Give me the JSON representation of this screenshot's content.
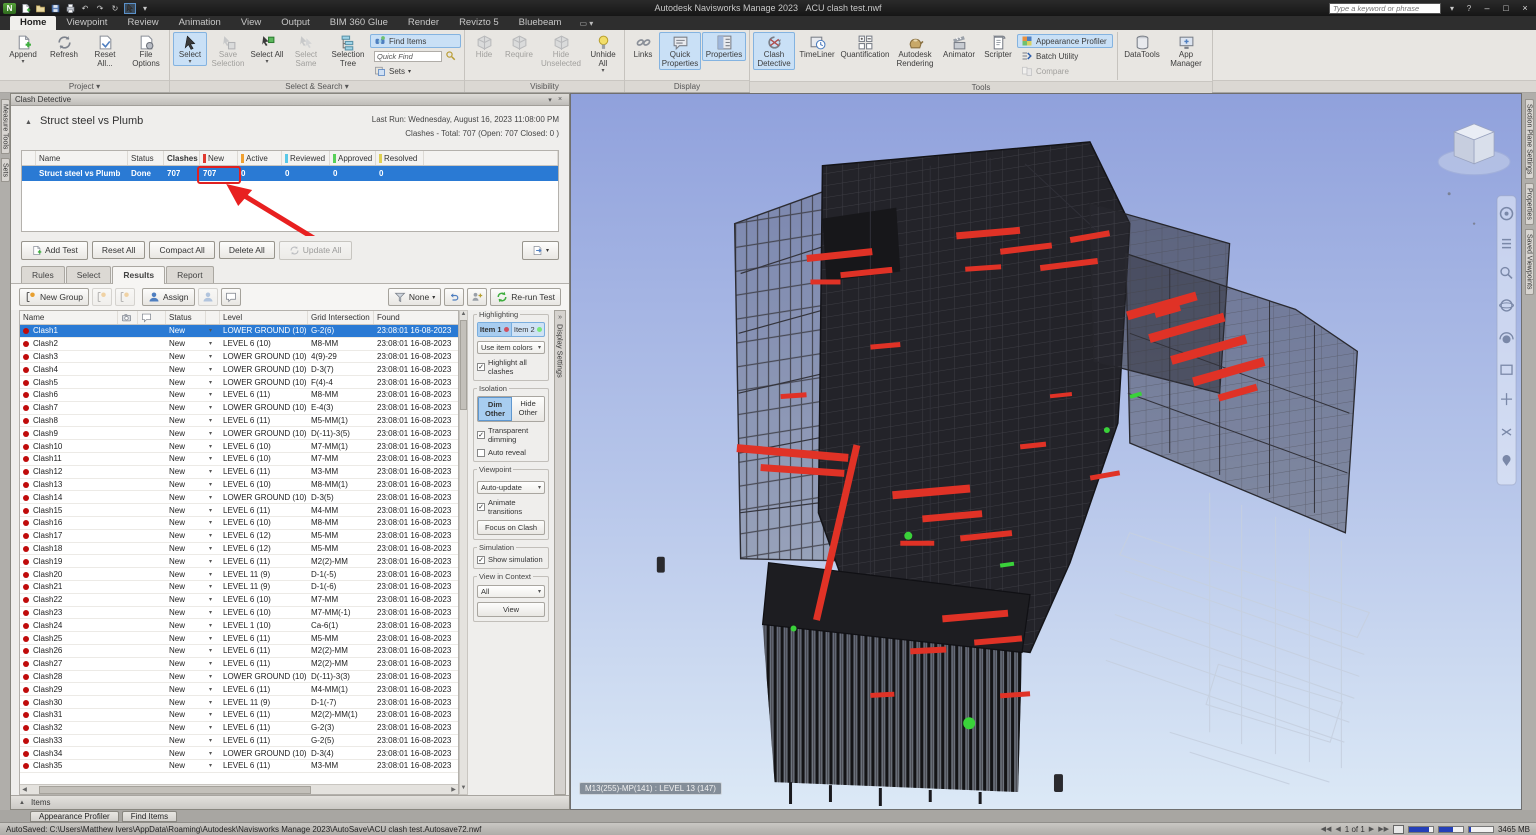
{
  "window": {
    "app_title": "Autodesk Navisworks Manage 2023",
    "doc_title": "ACU clash test.nwf",
    "search_placeholder": "Type a keyword or phrase"
  },
  "ribbon": {
    "tabs": [
      "Home",
      "Viewpoint",
      "Review",
      "Animation",
      "View",
      "Output",
      "BIM 360 Glue",
      "Render",
      "Revizto 5",
      "Bluebeam"
    ],
    "active_tab": "Home",
    "groups": {
      "project": {
        "label": "Project",
        "append": "Append",
        "refresh": "Refresh",
        "reset_all": "Reset All...",
        "file_options": "File Options"
      },
      "select_search": {
        "label": "Select & Search",
        "select": "Select",
        "save_selection": "Save Selection",
        "select_all": "Select All",
        "select_same": "Select Same",
        "selection_tree": "Selection Tree",
        "find_items": "Find Items",
        "quick_find": "Quick Find",
        "sets": "Sets"
      },
      "visibility": {
        "label": "Visibility",
        "hide": "Hide",
        "require": "Require",
        "hide_unselected": "Hide Unselected",
        "unhide_all": "Unhide All"
      },
      "display": {
        "label": "Display",
        "links": "Links",
        "quick_properties": "Quick Properties",
        "properties": "Properties"
      },
      "tools": {
        "label": "Tools",
        "clash_detective": "Clash Detective",
        "timeliner": "TimeLiner",
        "quantification": "Quantification",
        "autodesk_rendering": "Autodesk Rendering",
        "animator": "Animator",
        "scripter": "Scripter",
        "appearance_profiler": "Appearance Profiler",
        "batch_utility": "Batch Utility",
        "compare": "Compare",
        "datatools": "DataTools",
        "app_manager": "App Manager"
      }
    }
  },
  "clash_detective": {
    "panel_title": "Clash Detective",
    "test_name": "Struct steel vs Plumb",
    "last_run": "Last Run:  Wednesday, August 16, 2023 11:08:00 PM",
    "clashes_summary": "Clashes - Total: 707 (Open: 707 Closed: 0 )",
    "tests_table": {
      "headers": {
        "name": "Name",
        "status": "Status",
        "clashes": "Clashes",
        "new": "New",
        "active": "Active",
        "reviewed": "Reviewed",
        "approved": "Approved",
        "resolved": "Resolved"
      },
      "row": {
        "name": "Struct steel vs Plumb",
        "status": "Done",
        "clashes": "707",
        "new": "707",
        "active": "0",
        "reviewed": "0",
        "approved": "0",
        "resolved": "0"
      }
    },
    "actions": {
      "add_test": "Add Test",
      "reset_all": "Reset All",
      "compact_all": "Compact All",
      "delete_all": "Delete All",
      "update_all": "Update All"
    },
    "tabs": [
      "Rules",
      "Select",
      "Results",
      "Report"
    ],
    "active_tab": "Results",
    "toolbar": {
      "new_group": "New Group",
      "assign": "Assign",
      "filter": "None",
      "rerun": "Re-run Test"
    },
    "results": {
      "headers": {
        "name": "Name",
        "status": "Status",
        "level": "Level",
        "grid": "Grid Intersection",
        "found": "Found"
      },
      "rows": [
        {
          "name": "Clash1",
          "status": "New",
          "level": "LOWER GROUND (10)",
          "grid": "G-2(6)",
          "found": "23:08:01 16-08-2023"
        },
        {
          "name": "Clash2",
          "status": "New",
          "level": "LEVEL 6 (10)",
          "grid": "M8-MM",
          "found": "23:08:01 16-08-2023"
        },
        {
          "name": "Clash3",
          "status": "New",
          "level": "LOWER GROUND (10)",
          "grid": "4(9)-29",
          "found": "23:08:01 16-08-2023"
        },
        {
          "name": "Clash4",
          "status": "New",
          "level": "LOWER GROUND (10)",
          "grid": "D-3(7)",
          "found": "23:08:01 16-08-2023"
        },
        {
          "name": "Clash5",
          "status": "New",
          "level": "LOWER GROUND (10)",
          "grid": "F(4)-4",
          "found": "23:08:01 16-08-2023"
        },
        {
          "name": "Clash6",
          "status": "New",
          "level": "LEVEL 6 (11)",
          "grid": "M8-MM",
          "found": "23:08:01 16-08-2023"
        },
        {
          "name": "Clash7",
          "status": "New",
          "level": "LOWER GROUND (10)",
          "grid": "E-4(3)",
          "found": "23:08:01 16-08-2023"
        },
        {
          "name": "Clash8",
          "status": "New",
          "level": "LEVEL 6 (11)",
          "grid": "M5-MM(1)",
          "found": "23:08:01 16-08-2023"
        },
        {
          "name": "Clash9",
          "status": "New",
          "level": "LOWER GROUND (10)",
          "grid": "D(-11)-3(5)",
          "found": "23:08:01 16-08-2023"
        },
        {
          "name": "Clash10",
          "status": "New",
          "level": "LEVEL 6 (10)",
          "grid": "M7-MM(1)",
          "found": "23:08:01 16-08-2023"
        },
        {
          "name": "Clash11",
          "status": "New",
          "level": "LEVEL 6 (10)",
          "grid": "M7-MM",
          "found": "23:08:01 16-08-2023"
        },
        {
          "name": "Clash12",
          "status": "New",
          "level": "LEVEL 6 (11)",
          "grid": "M3-MM",
          "found": "23:08:01 16-08-2023"
        },
        {
          "name": "Clash13",
          "status": "New",
          "level": "LEVEL 6 (10)",
          "grid": "M8-MM(1)",
          "found": "23:08:01 16-08-2023"
        },
        {
          "name": "Clash14",
          "status": "New",
          "level": "LOWER GROUND (10)",
          "grid": "D-3(5)",
          "found": "23:08:01 16-08-2023"
        },
        {
          "name": "Clash15",
          "status": "New",
          "level": "LEVEL 6 (11)",
          "grid": "M4-MM",
          "found": "23:08:01 16-08-2023"
        },
        {
          "name": "Clash16",
          "status": "New",
          "level": "LEVEL 6 (10)",
          "grid": "M8-MM",
          "found": "23:08:01 16-08-2023"
        },
        {
          "name": "Clash17",
          "status": "New",
          "level": "LEVEL 6 (12)",
          "grid": "M5-MM",
          "found": "23:08:01 16-08-2023"
        },
        {
          "name": "Clash18",
          "status": "New",
          "level": "LEVEL 6 (12)",
          "grid": "M5-MM",
          "found": "23:08:01 16-08-2023"
        },
        {
          "name": "Clash19",
          "status": "New",
          "level": "LEVEL 6 (11)",
          "grid": "M2(2)-MM",
          "found": "23:08:01 16-08-2023"
        },
        {
          "name": "Clash20",
          "status": "New",
          "level": "LEVEL 11 (9)",
          "grid": "D-1(-5)",
          "found": "23:08:01 16-08-2023"
        },
        {
          "name": "Clash21",
          "status": "New",
          "level": "LEVEL 11 (9)",
          "grid": "D-1(-6)",
          "found": "23:08:01 16-08-2023"
        },
        {
          "name": "Clash22",
          "status": "New",
          "level": "LEVEL 6 (10)",
          "grid": "M7-MM",
          "found": "23:08:01 16-08-2023"
        },
        {
          "name": "Clash23",
          "status": "New",
          "level": "LEVEL 6 (10)",
          "grid": "M7-MM(-1)",
          "found": "23:08:01 16-08-2023"
        },
        {
          "name": "Clash24",
          "status": "New",
          "level": "LEVEL 1 (10)",
          "grid": "Ca-6(1)",
          "found": "23:08:01 16-08-2023"
        },
        {
          "name": "Clash25",
          "status": "New",
          "level": "LEVEL 6 (11)",
          "grid": "M5-MM",
          "found": "23:08:01 16-08-2023"
        },
        {
          "name": "Clash26",
          "status": "New",
          "level": "LEVEL 6 (11)",
          "grid": "M2(2)-MM",
          "found": "23:08:01 16-08-2023"
        },
        {
          "name": "Clash27",
          "status": "New",
          "level": "LEVEL 6 (11)",
          "grid": "M2(2)-MM",
          "found": "23:08:01 16-08-2023"
        },
        {
          "name": "Clash28",
          "status": "New",
          "level": "LOWER GROUND (10)",
          "grid": "D(-11)-3(3)",
          "found": "23:08:01 16-08-2023"
        },
        {
          "name": "Clash29",
          "status": "New",
          "level": "LEVEL 6 (11)",
          "grid": "M4-MM(1)",
          "found": "23:08:01 16-08-2023"
        },
        {
          "name": "Clash30",
          "status": "New",
          "level": "LEVEL 11 (9)",
          "grid": "D-1(-7)",
          "found": "23:08:01 16-08-2023"
        },
        {
          "name": "Clash31",
          "status": "New",
          "level": "LEVEL 6 (11)",
          "grid": "M2(2)-MM(1)",
          "found": "23:08:01 16-08-2023"
        },
        {
          "name": "Clash32",
          "status": "New",
          "level": "LEVEL 6 (11)",
          "grid": "G-2(3)",
          "found": "23:08:01 16-08-2023"
        },
        {
          "name": "Clash33",
          "status": "New",
          "level": "LEVEL 6 (11)",
          "grid": "G-2(5)",
          "found": "23:08:01 16-08-2023"
        },
        {
          "name": "Clash34",
          "status": "New",
          "level": "LOWER GROUND (10)",
          "grid": "D-3(4)",
          "found": "23:08:01 16-08-2023"
        },
        {
          "name": "Clash35",
          "status": "New",
          "level": "LEVEL 6 (11)",
          "grid": "M3-MM",
          "found": "23:08:01 16-08-2023"
        }
      ]
    },
    "options": {
      "highlighting": {
        "legend": "Highlighting",
        "item1": "Item 1",
        "item2": "Item 2",
        "use_item_colors": "Use item colors",
        "highlight_all": "Highlight all clashes"
      },
      "isolation": {
        "legend": "Isolation",
        "dim_other": "Dim Other",
        "hide_other": "Hide Other",
        "transparent": "Transparent dimming",
        "auto_reveal": "Auto reveal"
      },
      "viewpoint": {
        "legend": "Viewpoint",
        "mode": "Auto-update",
        "animate": "Animate transitions",
        "focus": "Focus on Clash"
      },
      "simulation": {
        "legend": "Simulation",
        "show": "Show simulation"
      },
      "view_in_context": {
        "legend": "View in Context",
        "value": "All",
        "view": "View"
      }
    },
    "display_settings": "Display Settings",
    "items_bar": "Items"
  },
  "side_tabs": {
    "left": [
      "Measure Tools",
      "Sets"
    ],
    "right": [
      "Section Plane Settings",
      "Properties",
      "Saved Viewpoints"
    ]
  },
  "viewport": {
    "selection_label": "M13(255)-MP(141) : LEVEL 13 (147)"
  },
  "statusbar": {
    "autosave": "AutoSaved: C:\\Users\\Matthew Ivers\\AppData\\Roaming\\Autodesk\\Navisworks Manage 2023\\AutoSave\\ACU clash test.Autosave72.nwf",
    "dock_tabs": [
      "Appearance Profiler",
      "Find Items"
    ],
    "page": "1 of 1",
    "memory": "3465 MB"
  },
  "colors": {
    "selection_blue": "#2a7ad4",
    "clash_red": "#e03226",
    "highlight_green": "#3ad23a",
    "tick_new": "#e03a2f",
    "tick_active": "#f0a030",
    "tick_reviewed": "#58c8e8",
    "tick_approved": "#58d058",
    "tick_resolved": "#e0d050"
  }
}
